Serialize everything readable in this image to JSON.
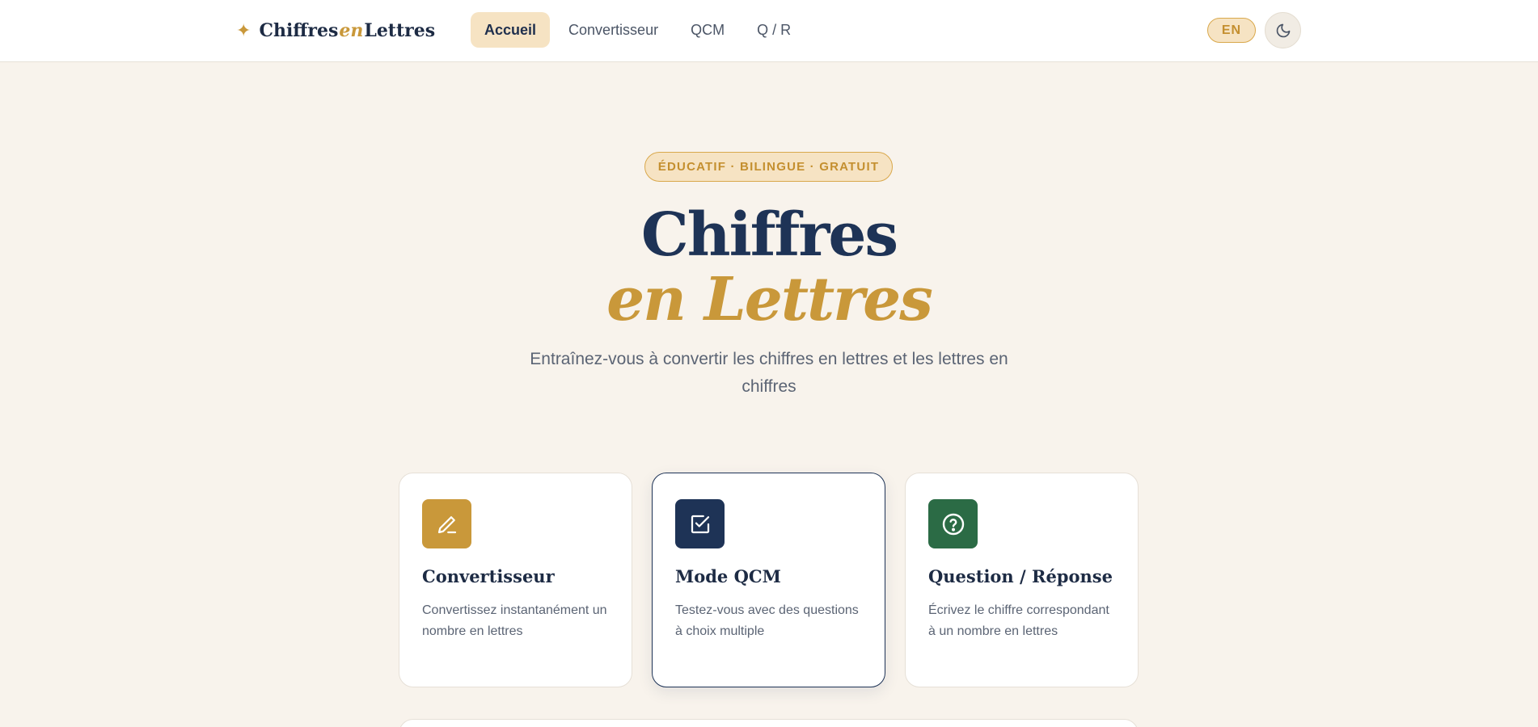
{
  "header": {
    "brand": {
      "part1": "Chiffres",
      "part2": "en",
      "part3": "Lettres"
    },
    "nav": [
      {
        "label": "Accueil",
        "active": true
      },
      {
        "label": "Convertisseur",
        "active": false
      },
      {
        "label": "QCM",
        "active": false
      },
      {
        "label": "Q / R",
        "active": false
      }
    ],
    "lang_label": "EN",
    "theme_icon": "moon-icon"
  },
  "hero": {
    "pill": "ÉDUCATIF · BILINGUE · GRATUIT",
    "title_line1": "Chiffres",
    "title_line2": "en Lettres",
    "subtitle": "Entraînez-vous à convertir les chiffres en lettres et les lettres en chiffres"
  },
  "cards": [
    {
      "title": "Convertisseur",
      "desc": "Convertissez instantanément un nombre en lettres",
      "icon": "pencil-icon",
      "color": "#c9983a"
    },
    {
      "title": "Mode QCM",
      "desc": "Testez-vous avec des questions à choix multiple",
      "icon": "checkbox-icon",
      "color": "#1e3356"
    },
    {
      "title": "Question / Réponse",
      "desc": "Écrivez le chiffre correspondant à un nombre en lettres",
      "icon": "question-circle-icon",
      "color": "#2b6b45"
    }
  ],
  "colors": {
    "accent": "#c9983a",
    "navy": "#1e3356",
    "green": "#2b6b45",
    "background": "#f8f3ec"
  }
}
